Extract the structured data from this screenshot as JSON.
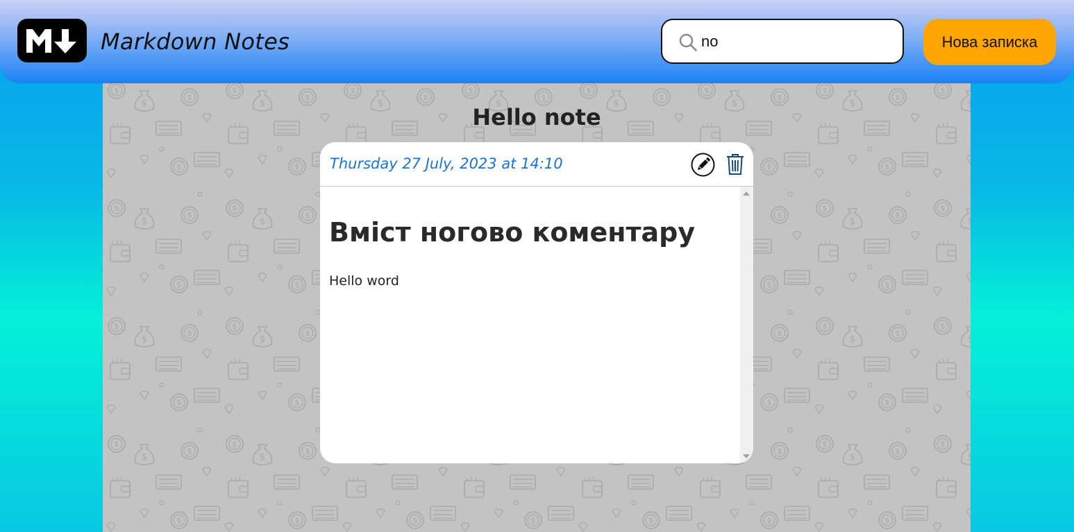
{
  "header": {
    "logo_icon": "markdown-logo-icon",
    "app_title": "Markdown Notes",
    "search": {
      "icon": "search-icon",
      "value": "no",
      "placeholder": ""
    },
    "new_note_label": "Нова записка"
  },
  "note": {
    "title": "Hello note",
    "date": "Thursday 27 July, 2023 at 14:10",
    "edit_icon": "pencil-icon",
    "delete_icon": "trash-icon",
    "body_heading": "Вміст ногово коментару",
    "body_text": "Hello word"
  },
  "colors": {
    "header_top": "#c9d0f4",
    "header_bottom": "#1a82f7",
    "accent_button": "#ffa502",
    "date_text": "#1a73d9",
    "page_background_mid": "#04f1d8",
    "panel_background": "#c3c3c3"
  }
}
